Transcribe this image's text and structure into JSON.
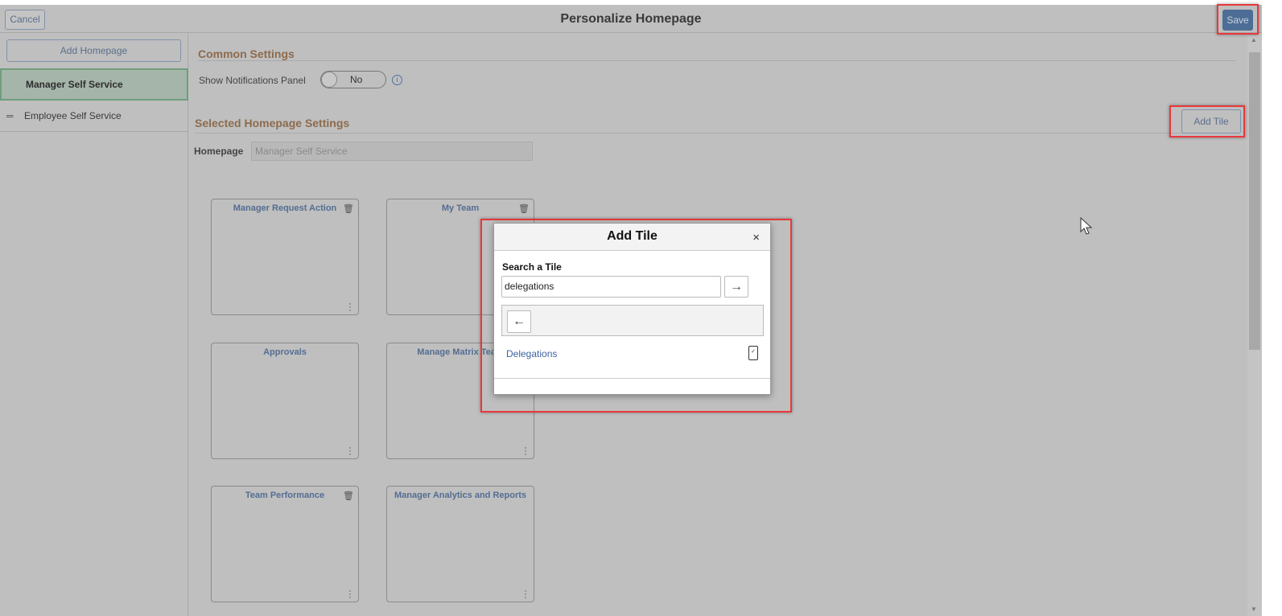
{
  "header": {
    "cancel_label": "Cancel",
    "title": "Personalize Homepage",
    "save_label": "Save"
  },
  "sidebar": {
    "add_homepage_label": "Add Homepage",
    "items": [
      {
        "label": "Manager Self Service",
        "selected": true
      },
      {
        "label": "Employee Self Service",
        "selected": false
      }
    ]
  },
  "main": {
    "common_settings": "Common Settings",
    "notifications_label": "Show Notifications Panel",
    "notifications_value": "No",
    "selected_settings": "Selected Homepage Settings",
    "add_tile_label": "Add Tile",
    "homepage_label": "Homepage",
    "homepage_value": "Manager Self Service",
    "tiles": [
      {
        "title": "Manager Request Action",
        "deletable": true
      },
      {
        "title": "My Team",
        "deletable": true
      },
      {
        "title": "Approvals",
        "deletable": false
      },
      {
        "title": "Manage Matrix Team",
        "deletable": false
      },
      {
        "title": "Team Performance",
        "deletable": true
      },
      {
        "title": "Manager Analytics and Reports",
        "deletable": false
      }
    ]
  },
  "modal": {
    "title": "Add Tile",
    "close": "×",
    "search_label": "Search a Tile",
    "search_value": "delegations",
    "go": "→",
    "back": "←",
    "results": [
      {
        "label": "Delegations",
        "icon": "mobile-icon"
      }
    ]
  },
  "colors": {
    "highlight": "#e8383c",
    "save": "#4d6d96",
    "section": "#8d6b4e",
    "link": "#3f63a0"
  }
}
